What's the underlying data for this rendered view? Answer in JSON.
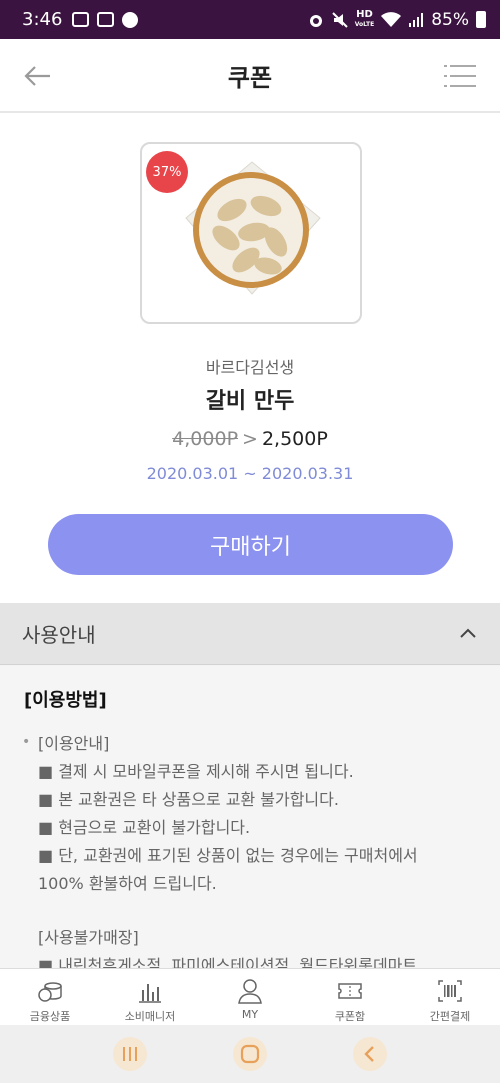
{
  "status_bar": {
    "time": "3:46",
    "hd_label": "HD",
    "voice_label": "VoLTE",
    "battery": "85%"
  },
  "header": {
    "title": "쿠폰"
  },
  "product": {
    "discount_badge": "37%",
    "brand": "바르다김선생",
    "name": "갈비 만두",
    "original_price": "4,000P",
    "price_separator": ">",
    "sale_price": "2,500P",
    "period": "2020.03.01 ~ 2020.03.31",
    "buy_label": "구매하기"
  },
  "usage": {
    "title": "사용안내",
    "section_title": "[이용방법]",
    "bullet": "•",
    "lines": [
      "[이용안내]",
      "■ 결제 시 모바일쿠폰을 제시해 주시면 됩니다.",
      "■ 본 교환권은 타 상품으로 교환 불가합니다.",
      "■ 현금으로 교환이 불가합니다.",
      "■ 단, 교환권에 표기된 상품이 없는 경우에는 구매처에서",
      "100% 환불하여 드립니다.",
      "[사용불가매장]",
      "■ 내린천휴게소점, 파미에스테이션점, 월드타워롯데마트"
    ]
  },
  "tabbar": {
    "items": [
      {
        "label": "금융상품",
        "icon": "coins-icon"
      },
      {
        "label": "소비매니저",
        "icon": "bar-chart-icon"
      },
      {
        "label": "MY",
        "icon": "user-icon"
      },
      {
        "label": "쿠폰함",
        "icon": "ticket-icon"
      },
      {
        "label": "간편결제",
        "icon": "barcode-icon"
      }
    ]
  },
  "colors": {
    "status_bar": "#3b1340",
    "accent": "#8c92ef",
    "period_text": "#7f8bd6",
    "badge": "#e8454a"
  }
}
